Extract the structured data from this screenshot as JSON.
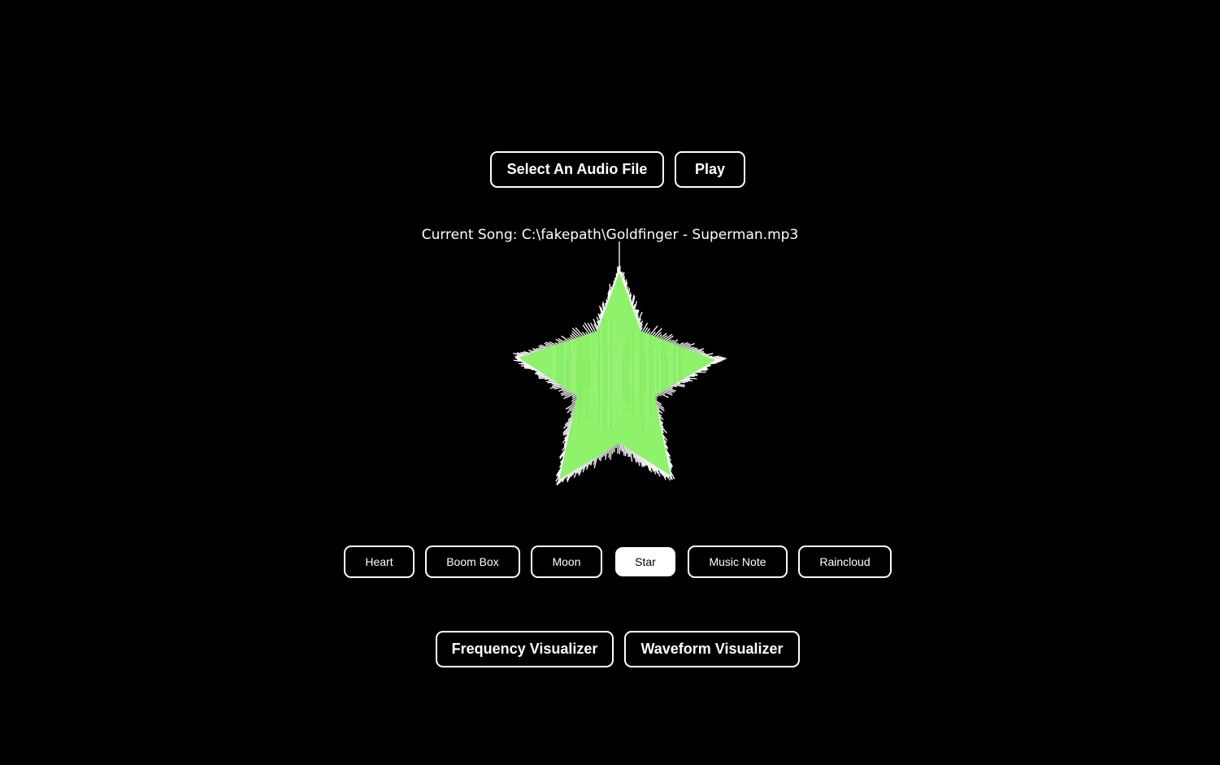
{
  "controls": {
    "select_file_label": "Select An Audio File",
    "play_label": "Play"
  },
  "now_playing": {
    "prefix": "Current Song:",
    "path": "C:\\fakepath\\Goldfinger - Superman.mp3"
  },
  "visualizer": {
    "shape": "star",
    "fill_color": "#8ef26a",
    "edge_color": "#ffffff"
  },
  "shapes": [
    {
      "label": "Heart",
      "active": false
    },
    {
      "label": "Boom Box",
      "active": false
    },
    {
      "label": "Moon",
      "active": false
    },
    {
      "label": "Star",
      "active": true
    },
    {
      "label": "Music Note",
      "active": false
    },
    {
      "label": "Raincloud",
      "active": false
    }
  ],
  "modes": {
    "frequency_label": "Frequency Visualizer",
    "waveform_label": "Waveform Visualizer"
  }
}
